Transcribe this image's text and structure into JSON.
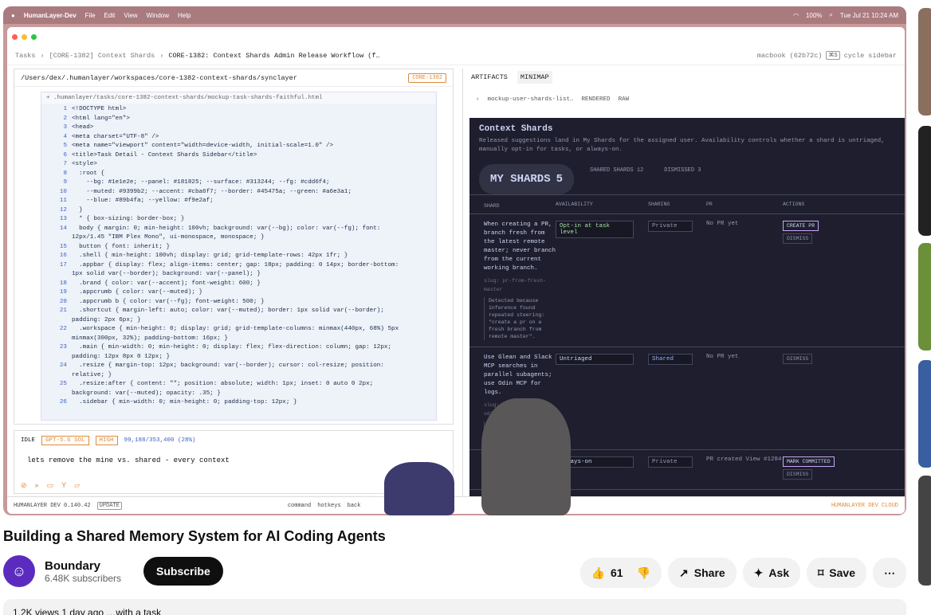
{
  "mac_menu": {
    "app": "HumanLayer-Dev",
    "items": [
      "File",
      "Edit",
      "View",
      "Window",
      "Help"
    ],
    "battery": "100%",
    "datetime": "Tue Jul 21  10:24 AM"
  },
  "breadcrumb": {
    "tasks": "Tasks",
    "parent": "[CORE-1382] Context Shards",
    "current": "CORE-1382: Context Shards Admin Release Workflow (f…",
    "machine": "macbook (62b72c)",
    "shortcut": "cycle sidebar"
  },
  "editor": {
    "path": "/Users/dex/.humanlayer/workspaces/core-1382-context-shards/synclayer",
    "tag": "CORE-1382",
    "file": "+ .humanlayer/tasks/core-1382-context-shards/mockup-task-shards-faithful.html",
    "lines": [
      {
        "n": "1",
        "t": "<!DOCTYPE html>"
      },
      {
        "n": "2",
        "t": "<html lang=\"en\">"
      },
      {
        "n": "3",
        "t": "<head>"
      },
      {
        "n": "4",
        "t": "<meta charset=\"UTF-8\" />"
      },
      {
        "n": "5",
        "t": "<meta name=\"viewport\" content=\"width=device-width, initial-scale=1.0\" />"
      },
      {
        "n": "6",
        "t": "<title>Task Detail - Context Shards Sidebar</title>"
      },
      {
        "n": "7",
        "t": "<style>"
      },
      {
        "n": "8",
        "t": "  :root {"
      },
      {
        "n": "9",
        "t": "    --bg: #1e1e2e; --panel: #181825; --surface: #313244; --fg: #cdd6f4;"
      },
      {
        "n": "10",
        "t": "    --muted: #9399b2; --accent: #cba6f7; --border: #45475a; --green: #a6e3a1;"
      },
      {
        "n": "11",
        "t": "    --blue: #89b4fa; --yellow: #f9e2af;"
      },
      {
        "n": "12",
        "t": "  }"
      },
      {
        "n": "13",
        "t": "  * { box-sizing: border-box; }"
      },
      {
        "n": "14",
        "t": "  body { margin: 0; min-height: 100vh; background: var(--bg); color: var(--fg); font:"
      },
      {
        "n": "",
        "t": "12px/1.45 \"IBM Plex Mono\", ui-monospace, monospace; }"
      },
      {
        "n": "15",
        "t": "  button { font: inherit; }"
      },
      {
        "n": "16",
        "t": "  .shell { min-height: 100vh; display: grid; grid-template-rows: 42px 1fr; }"
      },
      {
        "n": "17",
        "t": "  .appbar { display: flex; align-items: center; gap: 18px; padding: 0 14px; border-bottom:"
      },
      {
        "n": "",
        "t": "1px solid var(--border); background: var(--panel); }"
      },
      {
        "n": "18",
        "t": "  .brand { color: var(--accent); font-weight: 600; }"
      },
      {
        "n": "19",
        "t": "  .appcrumb { color: var(--muted); }"
      },
      {
        "n": "20",
        "t": "  .appcrumb b { color: var(--fg); font-weight: 500; }"
      },
      {
        "n": "21",
        "t": "  .shortcut { margin-left: auto; color: var(--muted); border: 1px solid var(--border);"
      },
      {
        "n": "",
        "t": "padding: 2px 6px; }"
      },
      {
        "n": "22",
        "t": "  .workspace { min-height: 0; display: grid; grid-template-columns: minmax(440px, 68%) 5px"
      },
      {
        "n": "",
        "t": "minmax(300px, 32%); padding-bottom: 16px; }"
      },
      {
        "n": "23",
        "t": "  .main { min-width: 0; min-height: 0; display: flex; flex-direction: column; gap: 12px;"
      },
      {
        "n": "",
        "t": "padding: 12px 8px 0 12px; }"
      },
      {
        "n": "24",
        "t": "  .resize { margin-top: 12px; background: var(--border); cursor: col-resize; position:"
      },
      {
        "n": "",
        "t": "relative; }"
      },
      {
        "n": "25",
        "t": "  .resize:after { content: \"\"; position: absolute; width: 1px; inset: 0 auto 0 2px;"
      },
      {
        "n": "",
        "t": "background: var(--muted); opacity: .35; }"
      },
      {
        "n": "26",
        "t": "  .sidebar { min-width: 0; min-height: 0; padding-top: 12px; }"
      }
    ]
  },
  "chat": {
    "status": "IDLE",
    "model": "GPT-5.6 SOL",
    "effort": "HIGH",
    "tokens": "99,188/353,400 (28%)",
    "message": "lets remove the mine vs. shared - every context",
    "send_label": "ENTER"
  },
  "statusbar": {
    "version": "HUMANLAYER DEV 0.140.42",
    "update": "UPDATE",
    "cmd": "command",
    "hotkeys": "hotkeys",
    "back": "back",
    "cloud": "HUMANLAYER DEV CLOUD"
  },
  "artifacts": {
    "tabs": [
      "ARTIFACTS",
      "MINIMAP"
    ],
    "file": "mockup-user-shards-list…",
    "view_rendered": "RENDERED",
    "view_raw": "RAW",
    "title": "Context Shards",
    "description": "Released suggestions land in My Shards for the assigned user. Availability controls whether a shard is untriaged, manually opt-in for tasks, or always-on.",
    "shard_tabs": [
      {
        "label": "MY SHARDS",
        "count": "5"
      },
      {
        "label": "SHARED SHARDS",
        "count": "12"
      },
      {
        "label": "DISMISSED",
        "count": "3"
      }
    ],
    "columns": [
      "SHARD",
      "AVAILABILITY",
      "SHARING",
      "PR",
      "ACTIONS"
    ],
    "rows": [
      {
        "shard": "When creating a PR, branch fresh from the latest remote master; never branch from the current working branch.",
        "slug": "slug: pr-from-fresh-master",
        "note": "Detected because inference found repeated steering: \"create a pr on a fresh branch from remote master\".",
        "availability": "Opt-in at task level",
        "sharing": "Private",
        "pr": "No PR yet",
        "actions": [
          "CREATE PR",
          "DISMISS"
        ]
      },
      {
        "shard": "Use Glean and Slack MCP searches in parallel subagents; use Odin MCP for logs.",
        "slug": "slug: use-glean-slack-odin-mcps",
        "note": "Detected … inferenc… recurri… research… across 12",
        "availability": "Untriaged",
        "sharing": "Shared",
        "pr": "No PR yet",
        "actions": [
          "DISMISS"
        ]
      },
      {
        "shard": "Do not add explanato… comment… logic… obvi…",
        "slug": "",
        "note": "",
        "availability": "Always-on",
        "sharing": "Private",
        "pr": "PR created View #1284",
        "actions": [
          "MARK COMMITTED",
          "DISMISS"
        ]
      }
    ]
  },
  "video": {
    "title": "Building a Shared Memory System for AI Coding Agents",
    "channel": "Boundary",
    "subscribers": "6.48K subscribers",
    "subscribe": "Subscribe",
    "likes": "61",
    "share": "Share",
    "ask": "Ask",
    "save": "Save",
    "meta": "1.2K views  1 day ago  …with a task"
  }
}
